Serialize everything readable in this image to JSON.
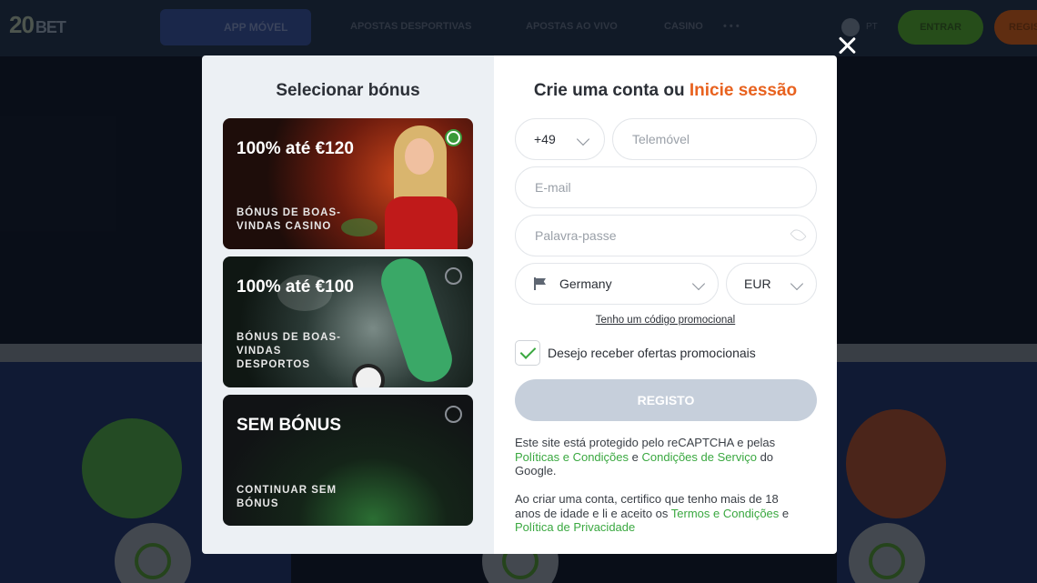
{
  "background": {
    "logo": {
      "num": "20",
      "text": "BET"
    },
    "app_button": "APP MÓVEL",
    "nav": [
      "APOSTAS DESPORTIVAS",
      "APOSTAS AO VIVO",
      "CASINO"
    ],
    "more": "• • •",
    "lang": "PT",
    "login_button": "ENTRAR",
    "register_button": "REGIS"
  },
  "left": {
    "title": "Selecionar bónus",
    "bonuses": [
      {
        "title": "100% até €120",
        "subtitle": "BÓNUS DE BOAS-VINDAS CASINO",
        "selected": true
      },
      {
        "title": "100% até €100",
        "subtitle": "BÓNUS DE BOAS-VINDAS DESPORTOS",
        "selected": false
      },
      {
        "title": "SEM BÓNUS",
        "subtitle": "CONTINUAR SEM BÓNUS",
        "selected": false
      }
    ]
  },
  "form": {
    "title_part1": "Crie uma conta ou ",
    "title_login": "Inicie sessão",
    "phone_code": "+49",
    "phone_placeholder": "Telemóvel",
    "email_placeholder": "E-mail",
    "password_placeholder": "Palavra-passe",
    "country": "Germany",
    "currency": "EUR",
    "promo_link": "Tenho um código promocional",
    "offers_label": "Desejo receber ofertas promocionais",
    "offers_checked": true,
    "register_button": "REGISTO",
    "legal1": {
      "text1": "Este site está protegido pelo reCAPTCHA e pelas ",
      "link1": "Políticas e Condições",
      "text2": " e ",
      "link2": "Condições de Serviço",
      "text3": " do Google."
    },
    "legal2": {
      "text1": "Ao criar uma conta, certifico que tenho mais de 18 anos de idade e li e aceito os ",
      "link1": "Termos e Condições",
      "text2": " e ",
      "link2": "Política de Privacidade"
    }
  },
  "colors": {
    "accent_orange": "#e8621f",
    "accent_green": "#3aa840",
    "button_disabled": "#c6cfdb"
  },
  "icons": {
    "close": "close-icon",
    "chevron": "chevron-down-icon",
    "flag": "flag-icon",
    "eye": "eye-icon",
    "check": "checkmark-icon",
    "radio": "radio-icon"
  }
}
